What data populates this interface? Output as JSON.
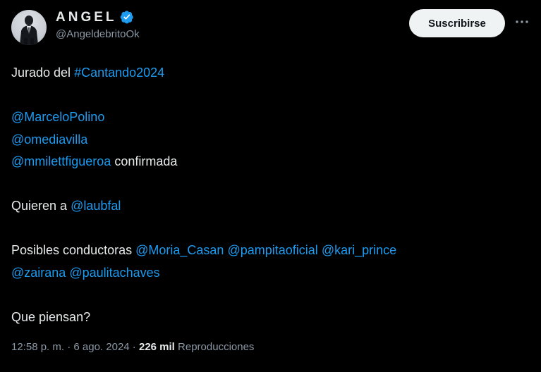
{
  "author": {
    "display_name": "ANGEL",
    "handle": "@AngeldebritoOk",
    "verified_icon": "verified-badge-icon",
    "verified_color": "#1d9bf0"
  },
  "actions": {
    "subscribe_label": "Suscribirse",
    "more_icon": "more-horizontal-icon"
  },
  "tweet": {
    "line1_prefix": "Jurado del ",
    "line1_hashtag": "#Cantando2024",
    "mention1": "@MarceloPolino",
    "mention2": "@omediavilla",
    "mention3": "@mmilettfigueroa",
    "mention3_suffix": " confirmada",
    "line5_prefix": "Quieren a ",
    "mention4": "@laubfal",
    "line6_prefix": "Posibles conductoras ",
    "mention5": "@Moria_Casan",
    "mention6": "@pampitaoficial",
    "mention7": "@kari_prince",
    "mention8": "@zairana",
    "mention9": "@paulitachaves",
    "closing": "Que piensan?"
  },
  "meta": {
    "time": "12:58 p. m.",
    "separator": " · ",
    "date": "6 ago. 2024",
    "views_count": "226 mil",
    "views_label": "Reproducciones"
  },
  "colors": {
    "background": "#000000",
    "text": "#e7e9ea",
    "secondary": "#8b98a5",
    "link": "#1d9bf0",
    "button_bg": "#eff3f4"
  }
}
